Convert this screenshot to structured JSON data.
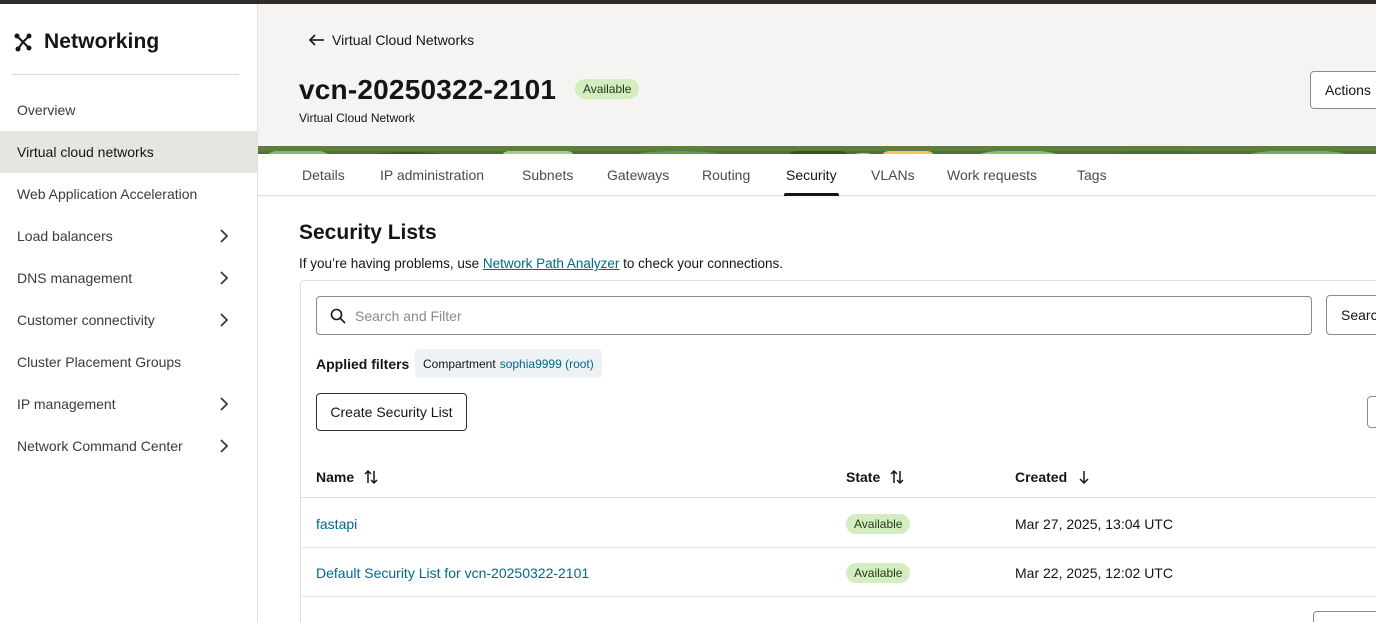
{
  "sidebar": {
    "title": "Networking",
    "items": [
      {
        "label": "Overview",
        "has_submenu": false,
        "active": false
      },
      {
        "label": "Virtual cloud networks",
        "has_submenu": false,
        "active": true
      },
      {
        "label": "Web Application Acceleration",
        "has_submenu": false,
        "active": false
      },
      {
        "label": "Load balancers",
        "has_submenu": true,
        "active": false
      },
      {
        "label": "DNS management",
        "has_submenu": true,
        "active": false
      },
      {
        "label": "Customer connectivity",
        "has_submenu": true,
        "active": false
      },
      {
        "label": "Cluster Placement Groups",
        "has_submenu": false,
        "active": false
      },
      {
        "label": "IP management",
        "has_submenu": true,
        "active": false
      },
      {
        "label": "Network Command Center",
        "has_submenu": true,
        "active": false
      }
    ]
  },
  "header": {
    "back_label": "Virtual Cloud Networks",
    "title": "vcn-20250322-2101",
    "status": "Available",
    "subtitle": "Virtual Cloud Network",
    "actions_label": "Actions"
  },
  "tabs": [
    {
      "label": "Details",
      "active": false
    },
    {
      "label": "IP administration",
      "active": false
    },
    {
      "label": "Subnets",
      "active": false
    },
    {
      "label": "Gateways",
      "active": false
    },
    {
      "label": "Routing",
      "active": false
    },
    {
      "label": "Security",
      "active": true
    },
    {
      "label": "VLANs",
      "active": false
    },
    {
      "label": "Work requests",
      "active": false
    },
    {
      "label": "Tags",
      "active": false
    }
  ],
  "section": {
    "title": "Security Lists",
    "help_prefix": "If you’re having problems, use ",
    "help_link": "Network Path Analyzer",
    "help_suffix": " to check your connections."
  },
  "search": {
    "placeholder": "Search and Filter",
    "value": "",
    "button_label": "Search"
  },
  "filters": {
    "label": "Applied filters",
    "chip_key": "Compartment",
    "chip_value": "sophia9999 (root)"
  },
  "create_button_label": "Create Security List",
  "table": {
    "columns": [
      "Name",
      "State",
      "Created"
    ],
    "rows": [
      {
        "name": "fastapi",
        "state": "Available",
        "created": "Mar 27, 2025, 13:04 UTC"
      },
      {
        "name": "Default Security List for vcn-20250322-2101",
        "state": "Available",
        "created": "Mar 22, 2025, 12:02 UTC"
      }
    ]
  },
  "colors": {
    "accent_link": "#00688c",
    "status_available_bg": "#d4edc0",
    "active_nav_bg": "#e7e5e2"
  },
  "icons": {
    "brand": "networking-icon",
    "back": "arrow-left-icon",
    "submenu": "chevron-right-icon",
    "search": "search-icon",
    "sort": "sort-icon",
    "sort_desc": "arrow-down-icon",
    "row_actions": "more-icon"
  }
}
